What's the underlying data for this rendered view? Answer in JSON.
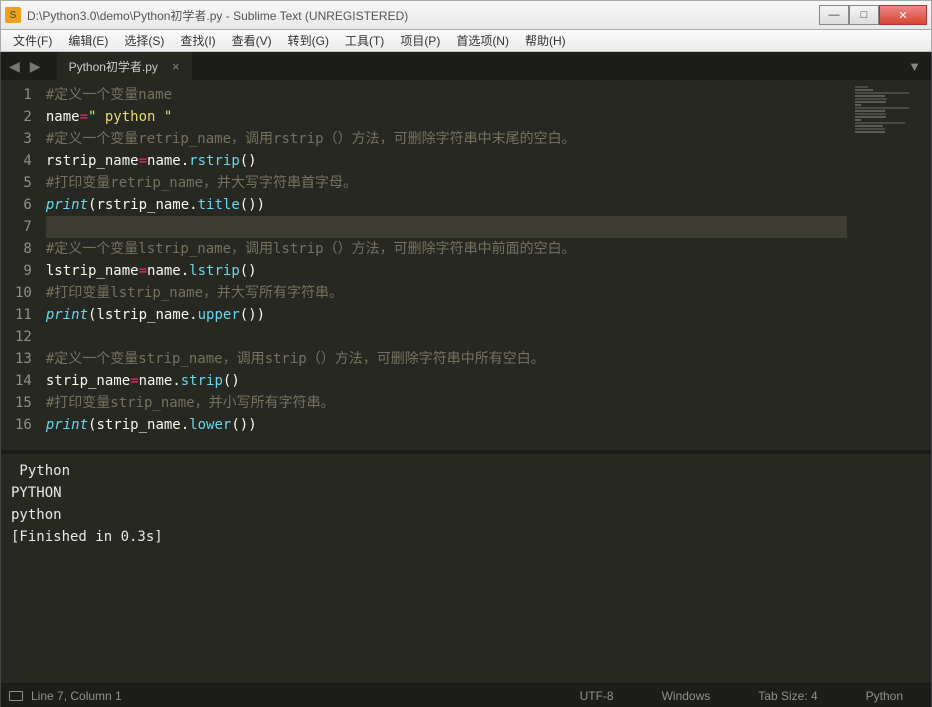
{
  "window": {
    "title": "D:\\Python3.0\\demo\\Python初学者.py - Sublime Text (UNREGISTERED)"
  },
  "menu": {
    "items": [
      "文件(F)",
      "编辑(E)",
      "选择(S)",
      "查找(I)",
      "查看(V)",
      "转到(G)",
      "工具(T)",
      "项目(P)",
      "首选项(N)",
      "帮助(H)"
    ]
  },
  "tab": {
    "name": "Python初学者.py"
  },
  "code_lines": [
    {
      "n": 1,
      "tokens": [
        [
          "c-comment",
          "#定义一个变量name"
        ]
      ]
    },
    {
      "n": 2,
      "tokens": [
        [
          "c-ident",
          "name"
        ],
        [
          "c-op",
          "="
        ],
        [
          "c-str",
          "\" python \""
        ]
      ]
    },
    {
      "n": 3,
      "tokens": [
        [
          "c-comment",
          "#定义一个变量retrip_name，调用rstrip（）方法，可删除字符串中末尾的空白。"
        ]
      ]
    },
    {
      "n": 4,
      "tokens": [
        [
          "c-ident",
          "rstrip_name"
        ],
        [
          "c-op",
          "="
        ],
        [
          "c-ident",
          "name"
        ],
        [
          "c-paren",
          "."
        ],
        [
          "c-call",
          "rstrip"
        ],
        [
          "c-paren",
          "()"
        ]
      ]
    },
    {
      "n": 5,
      "tokens": [
        [
          "c-comment",
          "#打印变量retrip_name，并大写字符串首字母。"
        ]
      ]
    },
    {
      "n": 6,
      "tokens": [
        [
          "c-func",
          "print"
        ],
        [
          "c-paren",
          "("
        ],
        [
          "c-ident",
          "rstrip_name"
        ],
        [
          "c-paren",
          "."
        ],
        [
          "c-call",
          "title"
        ],
        [
          "c-paren",
          "())"
        ]
      ]
    },
    {
      "n": 7,
      "tokens": [],
      "active": true
    },
    {
      "n": 8,
      "tokens": [
        [
          "c-comment",
          "#定义一个变量lstrip_name，调用lstrip（）方法，可删除字符串中前面的空白。"
        ]
      ]
    },
    {
      "n": 9,
      "tokens": [
        [
          "c-ident",
          "lstrip_name"
        ],
        [
          "c-op",
          "="
        ],
        [
          "c-ident",
          "name"
        ],
        [
          "c-paren",
          "."
        ],
        [
          "c-call",
          "lstrip"
        ],
        [
          "c-paren",
          "()"
        ]
      ]
    },
    {
      "n": 10,
      "tokens": [
        [
          "c-comment",
          "#打印变量lstrip_name，并大写所有字符串。"
        ]
      ]
    },
    {
      "n": 11,
      "tokens": [
        [
          "c-func",
          "print"
        ],
        [
          "c-paren",
          "("
        ],
        [
          "c-ident",
          "lstrip_name"
        ],
        [
          "c-paren",
          "."
        ],
        [
          "c-call",
          "upper"
        ],
        [
          "c-paren",
          "())"
        ]
      ]
    },
    {
      "n": 12,
      "tokens": []
    },
    {
      "n": 13,
      "tokens": [
        [
          "c-comment",
          "#定义一个变量strip_name，调用strip（）方法，可删除字符串中所有空白。"
        ]
      ]
    },
    {
      "n": 14,
      "tokens": [
        [
          "c-ident",
          "strip_name"
        ],
        [
          "c-op",
          "="
        ],
        [
          "c-ident",
          "name"
        ],
        [
          "c-paren",
          "."
        ],
        [
          "c-call",
          "strip"
        ],
        [
          "c-paren",
          "()"
        ]
      ]
    },
    {
      "n": 15,
      "tokens": [
        [
          "c-comment",
          "#打印变量strip_name，并小写所有字符串。"
        ]
      ]
    },
    {
      "n": 16,
      "tokens": [
        [
          "c-func",
          "print"
        ],
        [
          "c-paren",
          "("
        ],
        [
          "c-ident",
          "strip_name"
        ],
        [
          "c-paren",
          "."
        ],
        [
          "c-call",
          "lower"
        ],
        [
          "c-paren",
          "())"
        ]
      ]
    }
  ],
  "output_lines": [
    " Python",
    "PYTHON",
    "python",
    "[Finished in 0.3s]"
  ],
  "status": {
    "cursor": "Line 7, Column 1",
    "encoding": "UTF-8",
    "line_endings": "Windows",
    "tab_size": "Tab Size: 4",
    "syntax": "Python"
  }
}
